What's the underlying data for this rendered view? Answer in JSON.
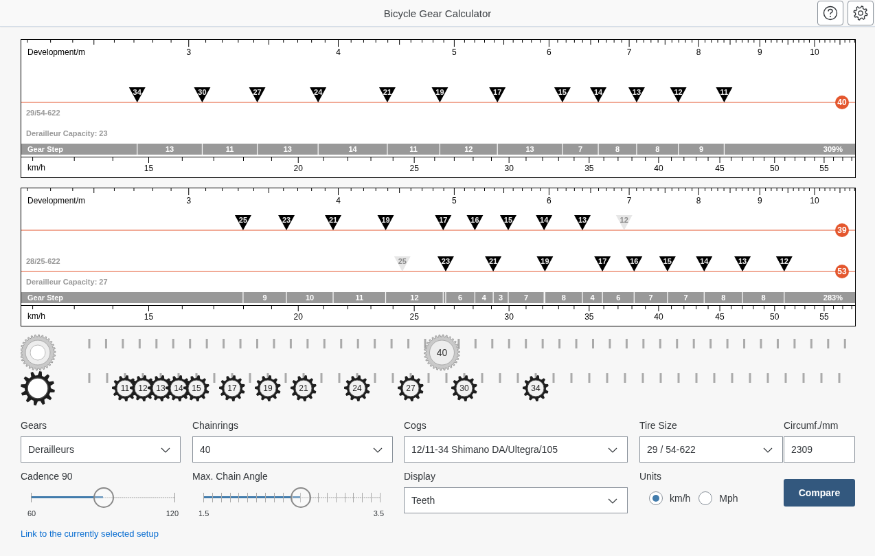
{
  "header": {
    "title": "Bicycle Gear Calculator"
  },
  "charts": [
    {
      "axis_label": "Development/m",
      "ticks": [
        "3",
        "4",
        "5",
        "6",
        "7",
        "8",
        "9",
        "10"
      ],
      "rows": [
        {
          "chainring": "40",
          "marks": [
            {
              "teeth": "34",
              "level": 0.139,
              "disabled": false
            },
            {
              "teeth": "30",
              "level": 0.217,
              "disabled": false
            },
            {
              "teeth": "27",
              "level": 0.283,
              "disabled": false
            },
            {
              "teeth": "24",
              "level": 0.356,
              "disabled": false
            },
            {
              "teeth": "21",
              "level": 0.439,
              "disabled": false
            },
            {
              "teeth": "19",
              "level": 0.502,
              "disabled": false
            },
            {
              "teeth": "17",
              "level": 0.571,
              "disabled": false
            },
            {
              "teeth": "15",
              "level": 0.649,
              "disabled": false
            },
            {
              "teeth": "14",
              "level": 0.692,
              "disabled": false
            },
            {
              "teeth": "13",
              "level": 0.738,
              "disabled": false
            },
            {
              "teeth": "12",
              "level": 0.788,
              "disabled": false
            },
            {
              "teeth": "11",
              "level": 0.843,
              "disabled": false
            }
          ]
        }
      ],
      "tire": "29/54-622",
      "capacity": "Derailleur Capacity: 23",
      "step_label": "Gear Step",
      "steps": [
        "13",
        "11",
        "13",
        "14",
        "11",
        "12",
        "13",
        "7",
        "8",
        "8",
        "9",
        "309%"
      ],
      "speed_axis": {
        "label": "km/h",
        "ticks": [
          "15",
          "20",
          "25",
          "30",
          "35",
          "40",
          "45",
          "50",
          "55"
        ]
      }
    },
    {
      "axis_label": "Development/m",
      "ticks": [
        "3",
        "4",
        "5",
        "6",
        "7",
        "8",
        "9",
        "10"
      ],
      "rows": [
        {
          "chainring": "39",
          "marks": [
            {
              "teeth": "25",
              "level": 0.266,
              "disabled": false
            },
            {
              "teeth": "23",
              "level": 0.318,
              "disabled": false
            },
            {
              "teeth": "21",
              "level": 0.374,
              "disabled": false
            },
            {
              "teeth": "19",
              "level": 0.437,
              "disabled": false
            },
            {
              "teeth": "17",
              "level": 0.506,
              "disabled": false
            },
            {
              "teeth": "16",
              "level": 0.544,
              "disabled": false
            },
            {
              "teeth": "15",
              "level": 0.584,
              "disabled": false
            },
            {
              "teeth": "14",
              "level": 0.627,
              "disabled": false
            },
            {
              "teeth": "13",
              "level": 0.673,
              "disabled": false
            },
            {
              "teeth": "12",
              "level": 0.723,
              "disabled": true
            }
          ]
        },
        {
          "chainring": "53",
          "marks": [
            {
              "teeth": "25",
              "level": 0.457,
              "disabled": true
            },
            {
              "teeth": "23",
              "level": 0.509,
              "disabled": false
            },
            {
              "teeth": "21",
              "level": 0.566,
              "disabled": false
            },
            {
              "teeth": "19",
              "level": 0.628,
              "disabled": false
            },
            {
              "teeth": "17",
              "level": 0.697,
              "disabled": false
            },
            {
              "teeth": "16",
              "level": 0.735,
              "disabled": false
            },
            {
              "teeth": "15",
              "level": 0.775,
              "disabled": false
            },
            {
              "teeth": "14",
              "level": 0.819,
              "disabled": false
            },
            {
              "teeth": "13",
              "level": 0.865,
              "disabled": false
            },
            {
              "teeth": "12",
              "level": 0.915,
              "disabled": false
            }
          ]
        }
      ],
      "tire": "28/25-622",
      "capacity": "Derailleur Capacity: 27",
      "step_label": "Gear Step",
      "steps": [
        "9",
        "10",
        "11",
        "12",
        "6",
        "4",
        "3",
        "7",
        "8",
        "4",
        "6",
        "7",
        "7",
        "8",
        "8",
        "283%"
      ],
      "speed_axis": {
        "label": "km/h",
        "ticks": [
          "15",
          "20",
          "25",
          "30",
          "35",
          "40",
          "45",
          "50",
          "55"
        ]
      }
    }
  ],
  "gear_view": {
    "chainrings": [
      {
        "teeth": "40"
      }
    ],
    "cogs": [
      {
        "teeth": "11"
      },
      {
        "teeth": "12"
      },
      {
        "teeth": "13"
      },
      {
        "teeth": "14"
      },
      {
        "teeth": "15"
      },
      {
        "teeth": "17"
      },
      {
        "teeth": "19"
      },
      {
        "teeth": "21"
      },
      {
        "teeth": "24"
      },
      {
        "teeth": "27"
      },
      {
        "teeth": "30"
      },
      {
        "teeth": "34"
      }
    ]
  },
  "controls": {
    "gears": {
      "label": "Gears",
      "value": "Derailleurs"
    },
    "chainrings": {
      "label": "Chainrings",
      "value": "40"
    },
    "cogs": {
      "label": "Cogs",
      "value": "12/11-34 Shimano DA/Ultegra/105"
    },
    "tire_size": {
      "label": "Tire Size",
      "value": "29 / 54-622"
    },
    "circumference": {
      "label": "Circumf./mm",
      "value": "2309"
    },
    "cadence": {
      "label": "Cadence",
      "value": "90",
      "min": "60",
      "max": "120",
      "level": 0.5
    },
    "chain_angle": {
      "label": "Max. Chain Angle",
      "min": "1.5",
      "max": "3.5",
      "level": 0.55
    },
    "display": {
      "label": "Display",
      "value": "Teeth"
    },
    "units": {
      "label": "Units",
      "options": [
        {
          "label": "km/h",
          "selected": true
        },
        {
          "label": "Mph",
          "selected": false
        }
      ]
    },
    "compare": "Compare",
    "link": "Link to the currently selected setup"
  }
}
